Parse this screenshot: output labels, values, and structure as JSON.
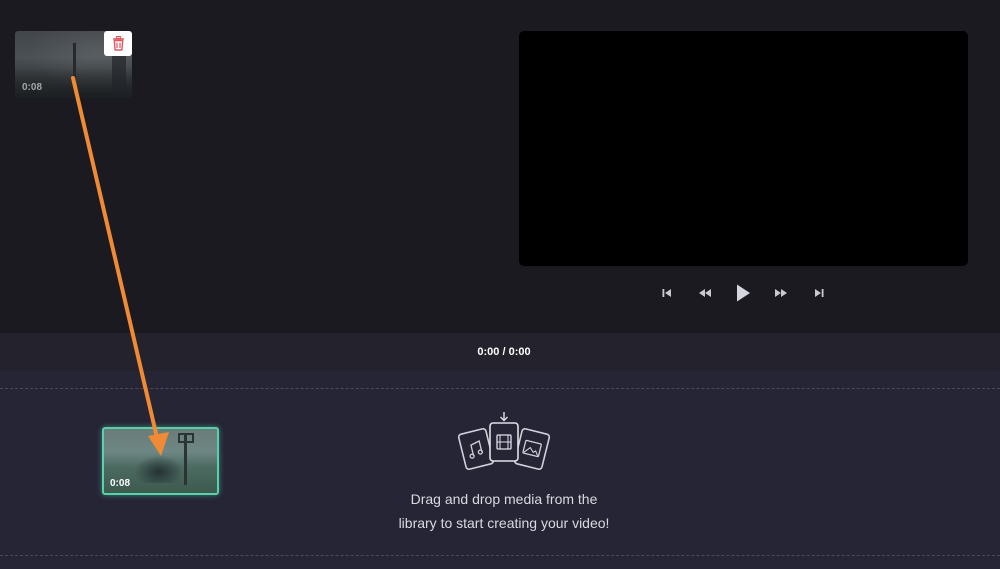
{
  "library": {
    "media": [
      {
        "duration": "0:08",
        "delete_icon": "trash-icon"
      }
    ]
  },
  "player": {
    "controls": [
      {
        "name": "skip-to-start-button",
        "icon": "skip-start-icon"
      },
      {
        "name": "rewind-button",
        "icon": "rewind-icon"
      },
      {
        "name": "play-button",
        "icon": "play-icon"
      },
      {
        "name": "fast-forward-button",
        "icon": "fast-forward-icon"
      },
      {
        "name": "skip-to-end-button",
        "icon": "skip-end-icon"
      }
    ]
  },
  "timebar": {
    "timecode": "0:00 / 0:00"
  },
  "timeline": {
    "dragged_clip": {
      "duration": "0:08"
    },
    "dropzone": {
      "line1": "Drag and drop media from the",
      "line2": "library to start creating your video!",
      "icon": "media-stack-icon"
    }
  },
  "colors": {
    "background": "#1b1a21",
    "timeline": "#262535",
    "accent": "#57d1aa",
    "delete": "#e0565f",
    "annotation_arrow": "#f08a34"
  }
}
